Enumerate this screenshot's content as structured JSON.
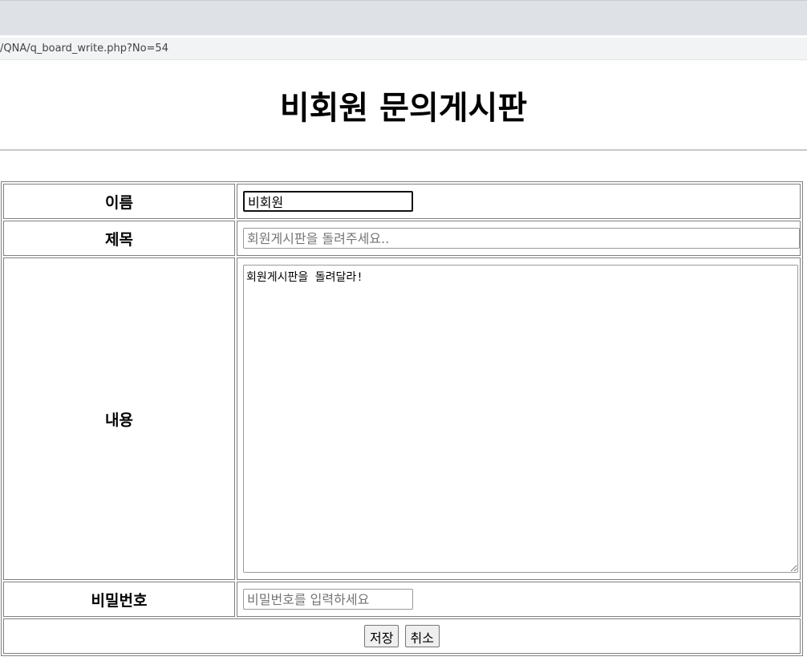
{
  "browser": {
    "url": "/QNA/q_board_write.php?No=54"
  },
  "page": {
    "title": "비회원 문의게시판"
  },
  "form": {
    "name_label": "이름",
    "name_value": "비회원",
    "subject_label": "제목",
    "subject_placeholder": "회원게시판을 돌려주세요..",
    "content_label": "내용",
    "content_value": "회원게시판을 돌려달라!",
    "password_label": "비밀번호",
    "password_placeholder": "비밀번호를 입력하세요",
    "save_label": "저장",
    "cancel_label": "취소"
  }
}
